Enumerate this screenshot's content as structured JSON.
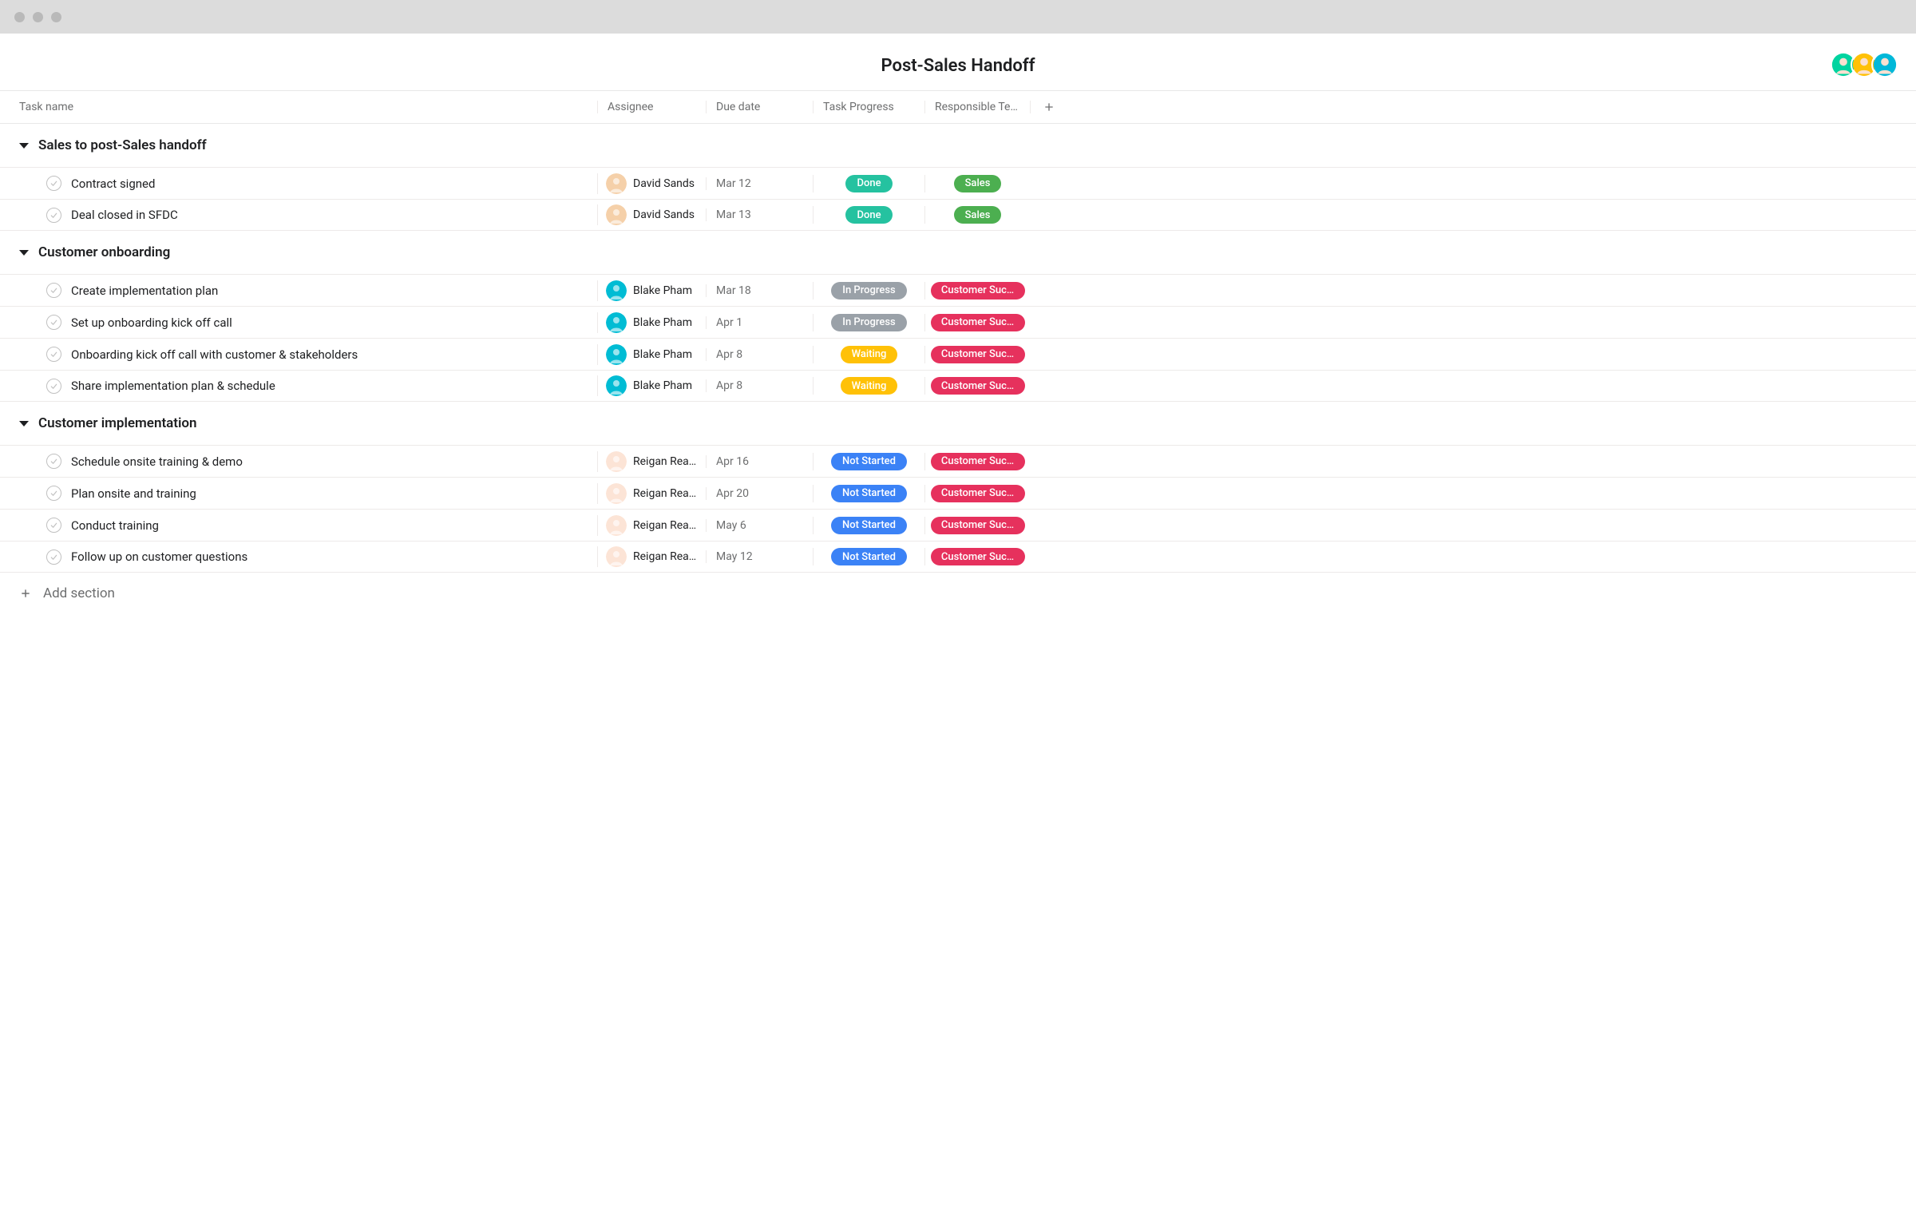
{
  "title": "Post-Sales Handoff",
  "columns": {
    "task": "Task name",
    "assignee": "Assignee",
    "due": "Due date",
    "progress": "Task Progress",
    "team": "Responsible Te…"
  },
  "collaborators": [
    {
      "ring": "#00d4a0"
    },
    {
      "ring": "#ffc107"
    },
    {
      "ring": "#00b8d9"
    }
  ],
  "progress_colors": {
    "Done": "#25c2a0",
    "In Progress": "#9aa1a8",
    "Waiting": "#ffc107",
    "Not Started": "#3b82f6"
  },
  "team_colors": {
    "Sales": "#4caf50",
    "Customer Suc…": "#e6315d"
  },
  "assignee_colors": {
    "David Sands": "#f5d0a9",
    "Blake Pham": "#00bcd4",
    "Reigan Rea…": "#fce4d6"
  },
  "sections": [
    {
      "title": "Sales to post-Sales handoff",
      "tasks": [
        {
          "name": "Contract signed",
          "assignee": "David Sands",
          "due": "Mar 12",
          "progress": "Done",
          "team": "Sales"
        },
        {
          "name": "Deal closed in SFDC",
          "assignee": "David Sands",
          "due": "Mar 13",
          "progress": "Done",
          "team": "Sales"
        }
      ]
    },
    {
      "title": "Customer onboarding",
      "tasks": [
        {
          "name": "Create implementation plan",
          "assignee": "Blake Pham",
          "due": "Mar 18",
          "progress": "In Progress",
          "team": "Customer Suc…"
        },
        {
          "name": "Set up onboarding kick off call",
          "assignee": "Blake Pham",
          "due": "Apr 1",
          "progress": "In Progress",
          "team": "Customer Suc…"
        },
        {
          "name": "Onboarding kick off call with customer & stakeholders",
          "assignee": "Blake Pham",
          "due": "Apr 8",
          "progress": "Waiting",
          "team": "Customer Suc…"
        },
        {
          "name": "Share implementation plan & schedule",
          "assignee": "Blake Pham",
          "due": "Apr 8",
          "progress": "Waiting",
          "team": "Customer Suc…"
        }
      ]
    },
    {
      "title": "Customer implementation",
      "tasks": [
        {
          "name": "Schedule onsite training & demo",
          "assignee": "Reigan Rea…",
          "due": "Apr 16",
          "progress": "Not Started",
          "team": "Customer Suc…"
        },
        {
          "name": "Plan onsite and training",
          "assignee": "Reigan Rea…",
          "due": "Apr 20",
          "progress": "Not Started",
          "team": "Customer Suc…"
        },
        {
          "name": "Conduct training",
          "assignee": "Reigan Rea…",
          "due": "May 6",
          "progress": "Not Started",
          "team": "Customer Suc…"
        },
        {
          "name": "Follow up on customer questions",
          "assignee": "Reigan Rea…",
          "due": "May 12",
          "progress": "Not Started",
          "team": "Customer Suc…"
        }
      ]
    }
  ],
  "add_section_label": "Add section"
}
